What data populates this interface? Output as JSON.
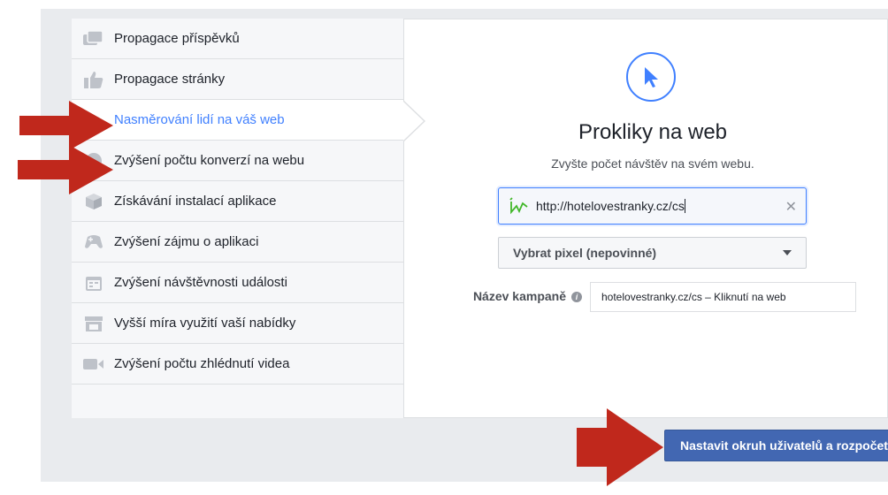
{
  "sidebar": {
    "items": [
      {
        "label": "Propagace příspěvků",
        "icon": "posts-icon"
      },
      {
        "label": "Propagace stránky",
        "icon": "like-icon"
      },
      {
        "label": "Nasměrování lidí na váš web",
        "icon": "cursor-icon",
        "selected": true
      },
      {
        "label": "Zvýšení počtu konverzí na webu",
        "icon": "globe-icon"
      },
      {
        "label": "Získávání instalací aplikace",
        "icon": "box-icon"
      },
      {
        "label": "Zvýšení zájmu o aplikaci",
        "icon": "gamepad-icon"
      },
      {
        "label": "Zvýšení návštěvnosti události",
        "icon": "calendar-icon"
      },
      {
        "label": "Vyšší míra využití vaší nabídky",
        "icon": "store-icon"
      },
      {
        "label": "Zvýšení počtu zhlédnutí videa",
        "icon": "video-icon"
      }
    ]
  },
  "main": {
    "hero_icon": "cursor-icon",
    "title": "Prokliky na web",
    "subtitle": "Zvyšte počet návštěv na svém webu.",
    "url_field": {
      "value": "http://hotelovestranky.cz/cs",
      "valid_icon": "checkmark-icon"
    },
    "pixel_select": {
      "selected": "Vybrat pixel (nepovinné)"
    },
    "campaign_name": {
      "label": "Název kampaně",
      "value": "hotelovestranky.cz/cs – Kliknutí na web"
    }
  },
  "footer": {
    "primary_button": "Nastavit okruh uživatelů a rozpočet"
  },
  "colors": {
    "accent": "#4080ff",
    "button": "#4267b2",
    "annotation_arrow": "#c0281c"
  }
}
